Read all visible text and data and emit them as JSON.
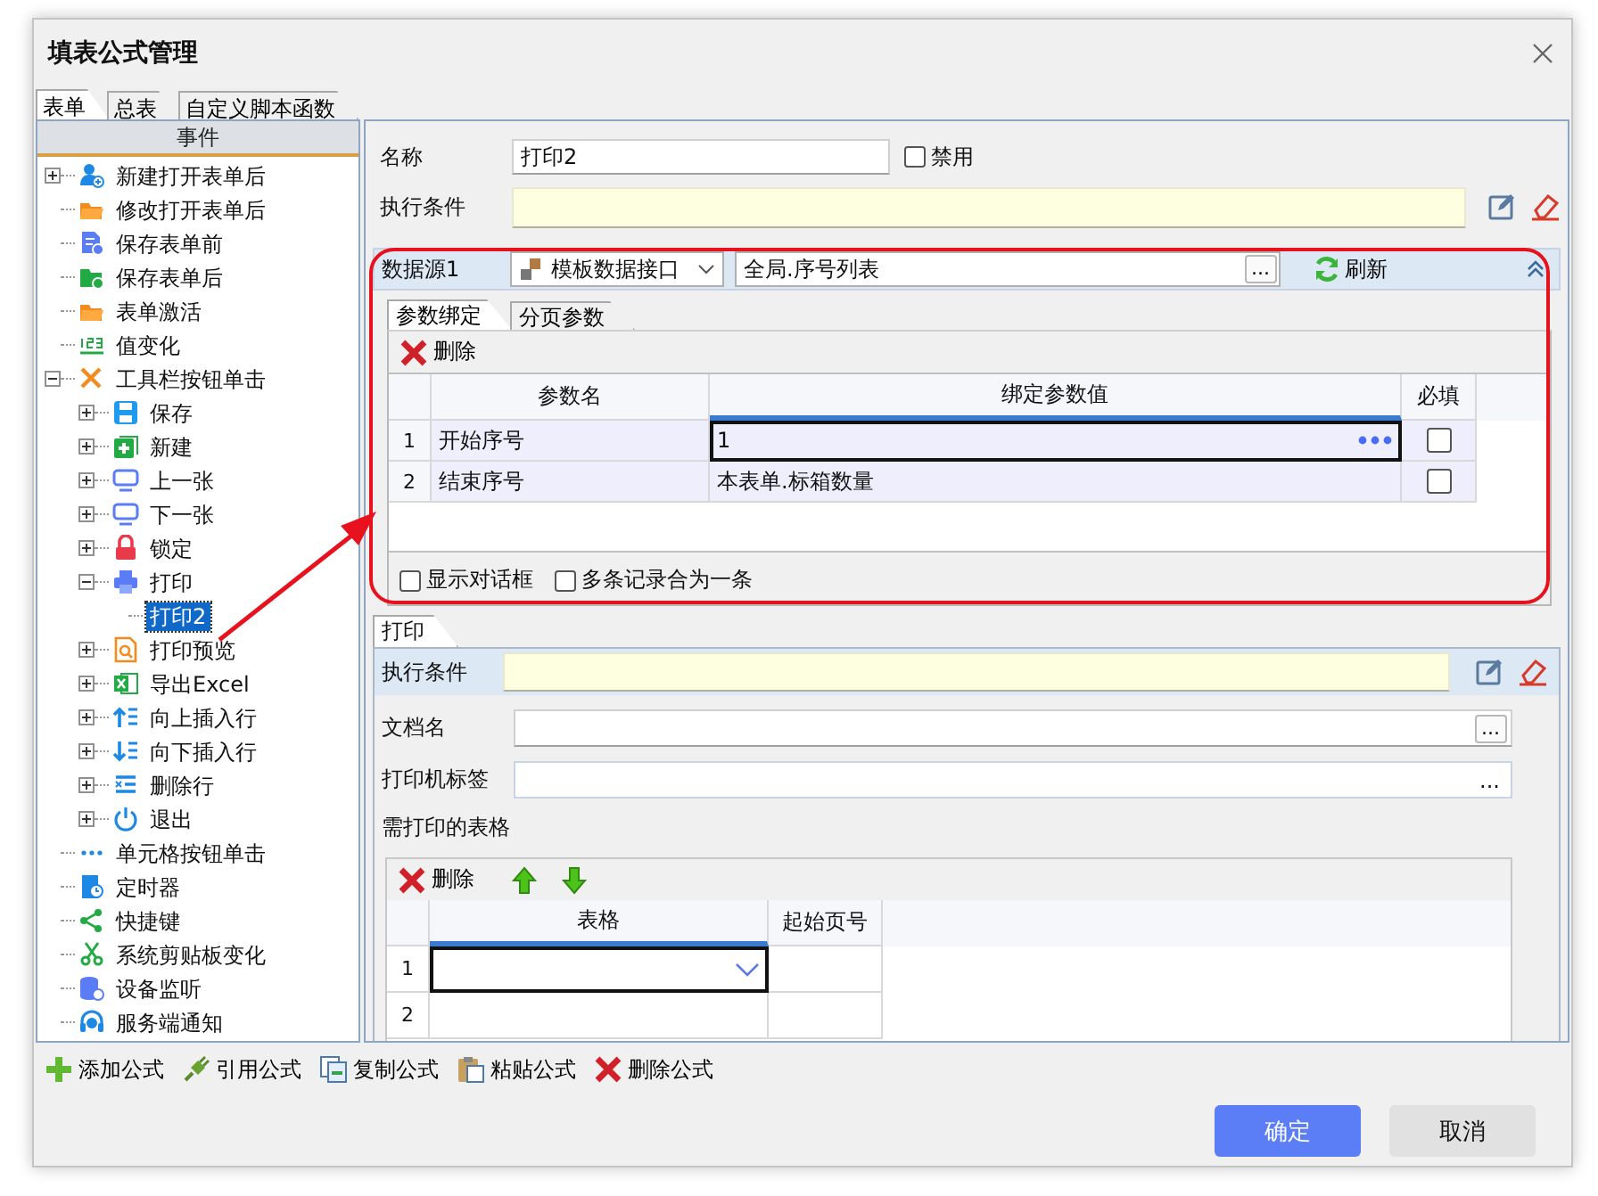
{
  "window": {
    "title": "填表公式管理"
  },
  "tabs": [
    {
      "label": "表单",
      "selected": true
    },
    {
      "label": "总表",
      "selected": false
    },
    {
      "label": "自定义脚本函数",
      "selected": false
    }
  ],
  "event_tree": {
    "header": "事件",
    "items": [
      {
        "label": "新建打开表单后",
        "kind": "user-add",
        "expanded": false,
        "selected": false
      },
      {
        "label": "修改打开表单后",
        "kind": "folder",
        "selected": false
      },
      {
        "label": "保存表单前",
        "kind": "doc-check",
        "selected": false
      },
      {
        "label": "保存表单后",
        "kind": "folder-check",
        "selected": false
      },
      {
        "label": "表单激活",
        "kind": "folder",
        "selected": false
      },
      {
        "label": "值变化",
        "kind": "numbers",
        "selected": false
      },
      {
        "label": "工具栏按钮单击",
        "kind": "tools",
        "expanded": true,
        "selected": false,
        "children": [
          {
            "label": "保存",
            "kind": "save",
            "expanded": false,
            "selected": false
          },
          {
            "label": "新建",
            "kind": "new",
            "expanded": false,
            "selected": false
          },
          {
            "label": "上一张",
            "kind": "monitor",
            "expanded": false,
            "selected": false
          },
          {
            "label": "下一张",
            "kind": "monitor",
            "expanded": false,
            "selected": false
          },
          {
            "label": "锁定",
            "kind": "lock",
            "expanded": false,
            "selected": false
          },
          {
            "label": "打印",
            "kind": "printer",
            "expanded": true,
            "selected": false,
            "children": [
              {
                "label": "打印2",
                "selected": true
              }
            ]
          },
          {
            "label": "打印预览",
            "kind": "preview",
            "expanded": false,
            "selected": false
          },
          {
            "label": "导出Excel",
            "kind": "excel",
            "expanded": false,
            "selected": false
          },
          {
            "label": "向上插入行",
            "kind": "insert-up",
            "expanded": false,
            "selected": false
          },
          {
            "label": "向下插入行",
            "kind": "insert-down",
            "expanded": false,
            "selected": false
          },
          {
            "label": "删除行",
            "kind": "delete-row",
            "expanded": false,
            "selected": false
          },
          {
            "label": "退出",
            "kind": "power",
            "expanded": false,
            "selected": false
          }
        ]
      },
      {
        "label": "单元格按钮单击",
        "kind": "dots",
        "selected": false
      },
      {
        "label": "定时器",
        "kind": "timer",
        "selected": false
      },
      {
        "label": "快捷键",
        "kind": "share",
        "selected": false
      },
      {
        "label": "系统剪贴板变化",
        "kind": "scissors",
        "selected": false
      },
      {
        "label": "设备监听",
        "kind": "database",
        "selected": false
      },
      {
        "label": "服务端通知",
        "kind": "headset",
        "selected": false
      }
    ]
  },
  "formula": {
    "name_label": "名称",
    "name_value": "打印2",
    "disabled": {
      "label": "禁用",
      "checked": false
    },
    "condition_label": "执行条件"
  },
  "data_source": {
    "label": "数据源1",
    "source_type": "模板数据接口",
    "source": "全局.序号列表",
    "browse": "...",
    "refresh": "刷新",
    "tabs": [
      {
        "label": "参数绑定",
        "selected": true
      },
      {
        "label": "分页参数",
        "selected": false
      }
    ],
    "delete": "删除",
    "columns": [
      "参数名",
      "绑定参数值",
      "必填"
    ],
    "rows": [
      {
        "number": "1",
        "name": "开始序号",
        "value": "1",
        "required": false,
        "selected": true
      },
      {
        "number": "2",
        "name": "结束序号",
        "value": "本表单.标箱数量",
        "required": false,
        "selected": false
      }
    ],
    "options": [
      {
        "label": "显示对话框",
        "checked": false
      },
      {
        "label": "多条记录合为一条",
        "checked": false
      }
    ]
  },
  "action": {
    "tab": "打印",
    "condition_label": "执行条件",
    "document_label": "文档名",
    "document_browse": "...",
    "printer_label": "打印机标签",
    "printer_browse": "...",
    "tables_label": "需打印的表格",
    "delete": "删除",
    "columns": [
      "表格",
      "起始页号"
    ],
    "rows": [
      {
        "number": "1",
        "selected": true
      },
      {
        "number": "2",
        "selected": false
      }
    ]
  },
  "toolbar": [
    {
      "kind": "add",
      "label": "添加公式"
    },
    {
      "kind": "reference",
      "label": "引用公式"
    },
    {
      "kind": "copy",
      "label": "复制公式"
    },
    {
      "kind": "paste",
      "label": "粘贴公式"
    },
    {
      "kind": "delete",
      "label": "删除公式"
    }
  ],
  "buttons": [
    {
      "kind": "primary",
      "label": "确定"
    },
    {
      "kind": "secondary",
      "label": "取消"
    }
  ]
}
